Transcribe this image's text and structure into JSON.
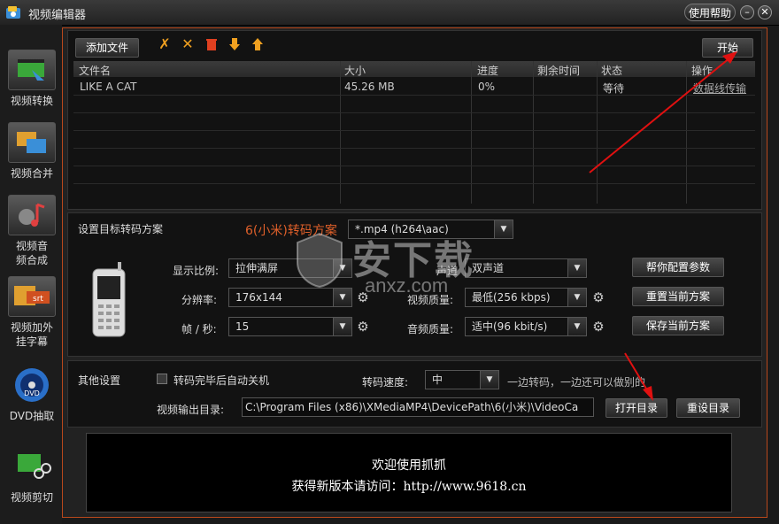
{
  "window": {
    "title": "视频编辑器",
    "help_label": "使用帮助",
    "minimize_glyph": "–",
    "close_glyph": "✕"
  },
  "sidebar": {
    "items": [
      {
        "label": "视频转换",
        "icon": "film-convert-icon"
      },
      {
        "label": "视频合并",
        "icon": "film-merge-icon"
      },
      {
        "label": "视频音频合成",
        "icon": "music-note-icon"
      },
      {
        "label": "视频加外挂字幕",
        "icon": "subtitle-srt-icon",
        "badge": "srt"
      },
      {
        "label": "DVD抽取",
        "icon": "dvd-disc-icon",
        "badge": "DVD"
      },
      {
        "label": "视频剪切",
        "icon": "scissors-film-icon"
      }
    ]
  },
  "toolbar": {
    "add_file_label": "添加文件",
    "start_label": "开始",
    "icons": [
      "tools-icon",
      "delete-x-icon",
      "trash-icon",
      "move-down-icon",
      "move-up-icon"
    ]
  },
  "file_table": {
    "columns": [
      "文件名",
      "大小",
      "进度",
      "剩余时间",
      "状态",
      "操作"
    ],
    "rows": [
      {
        "name": "LIKE A CAT",
        "size": "45.26 MB",
        "progress": "0%",
        "remaining": "",
        "status": "等待",
        "action": "数据线传输"
      }
    ]
  },
  "transcode": {
    "section_label": "设置目标转码方案",
    "scheme_name": "6(小米)转码方案",
    "format_value": "*.mp4 (h264\\aac)",
    "aspect_label": "显示比例:",
    "aspect_value": "拉伸满屏",
    "resolution_label": "分辨率:",
    "resolution_value": "176x144",
    "fps_label": "帧 / 秒:",
    "fps_value": "15",
    "channel_label": "声道",
    "channel_value": "双声道",
    "video_quality_label": "视频质量:",
    "video_quality_value": "最低(256 kbps)",
    "audio_quality_label": "音频质量:",
    "audio_quality_value": "适中(96 kbit/s)",
    "help_config_label": "帮你配置参数",
    "reset_scheme_label": "重置当前方案",
    "save_scheme_label": "保存当前方案"
  },
  "other": {
    "section_label": "其他设置",
    "auto_shutdown_label": "转码完毕后自动关机",
    "speed_label": "转码速度:",
    "speed_value": "中",
    "speed_hint": "一边转码，一边还可以做别的",
    "output_dir_label": "视频输出目录:",
    "output_dir_value": "C:\\Program Files (x86)\\XMediaMP4\\DevicePath\\6(小米)\\VideoCa",
    "open_dir_label": "打开目录",
    "reset_dir_label": "重设目录"
  },
  "banner": {
    "line1": "欢迎使用抓抓",
    "line2": "获得新版本请访问：http://www.9618.cn"
  },
  "watermark": {
    "main": "安下载",
    "sub": "anxz.com"
  },
  "colors": {
    "accent_border": "#b8481c",
    "scheme_name": "#e0602a",
    "annotation_arrow": "#e01010",
    "tool_orange": "#f0a020",
    "trash_red": "#e04020"
  }
}
